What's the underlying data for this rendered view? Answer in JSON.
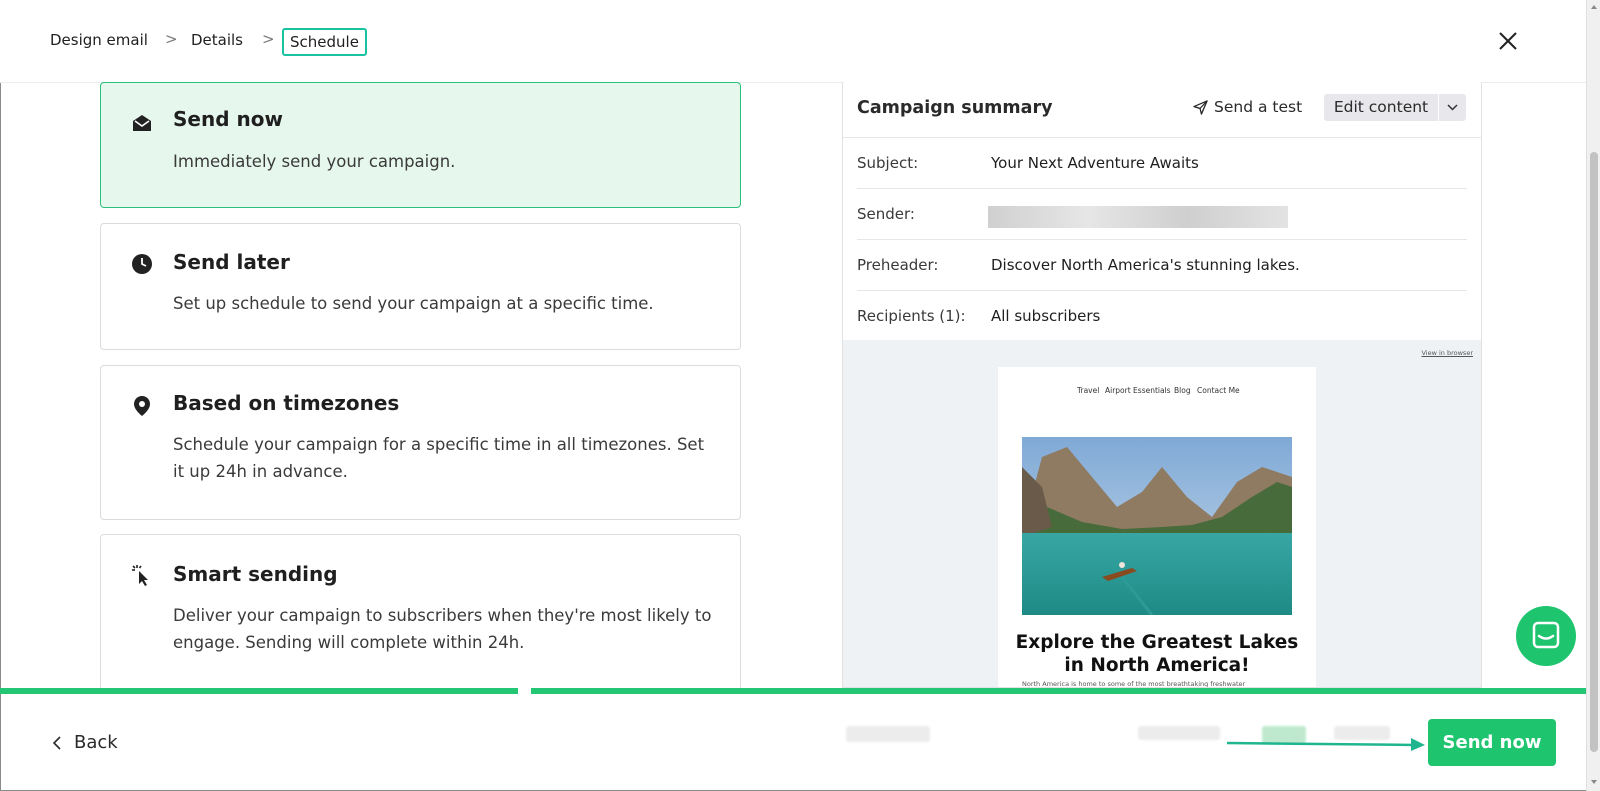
{
  "breadcrumb": {
    "items": [
      "Design email",
      "Details",
      "Schedule"
    ],
    "separator": ">"
  },
  "options": [
    {
      "title": "Send now",
      "description": "Immediately send your campaign.",
      "icon": "envelope-open-icon",
      "selected": true
    },
    {
      "title": "Send later",
      "description": "Set up schedule to send your campaign at a specific time.",
      "icon": "clock-icon",
      "selected": false
    },
    {
      "title": "Based on timezones",
      "description": "Schedule your campaign for a specific time in all timezones. Set it up 24h in advance.",
      "icon": "location-pin-icon",
      "selected": false
    },
    {
      "title": "Smart sending",
      "description": "Deliver your campaign to subscribers when they're most likely to engage. Sending will complete within 24h.",
      "icon": "cursor-click-icon",
      "selected": false
    }
  ],
  "summary": {
    "title": "Campaign summary",
    "send_test_label": "Send a test",
    "edit_content_label": "Edit content",
    "rows": [
      {
        "label": "Subject:",
        "value": "Your Next Adventure Awaits"
      },
      {
        "label": "Sender:",
        "value": ""
      },
      {
        "label": "Preheader:",
        "value": "Discover North America's stunning lakes."
      },
      {
        "label": "Recipients (1):",
        "value": "All subscribers"
      }
    ]
  },
  "email_preview": {
    "view_in_browser": "View in browser",
    "nav": [
      "Travel",
      "Airport Essentials",
      "Blog",
      "Contact Me"
    ],
    "heading": "Explore the Greatest Lakes in North America!",
    "body_snippet": "North America is home to some of the most breathtaking freshwater"
  },
  "footer": {
    "back_label": "Back",
    "send_now_label": "Send now"
  },
  "colors": {
    "accent_green": "#1fc46f",
    "selected_bg": "#e6f7ee",
    "breadcrumb_highlight": "#19c2a1"
  }
}
